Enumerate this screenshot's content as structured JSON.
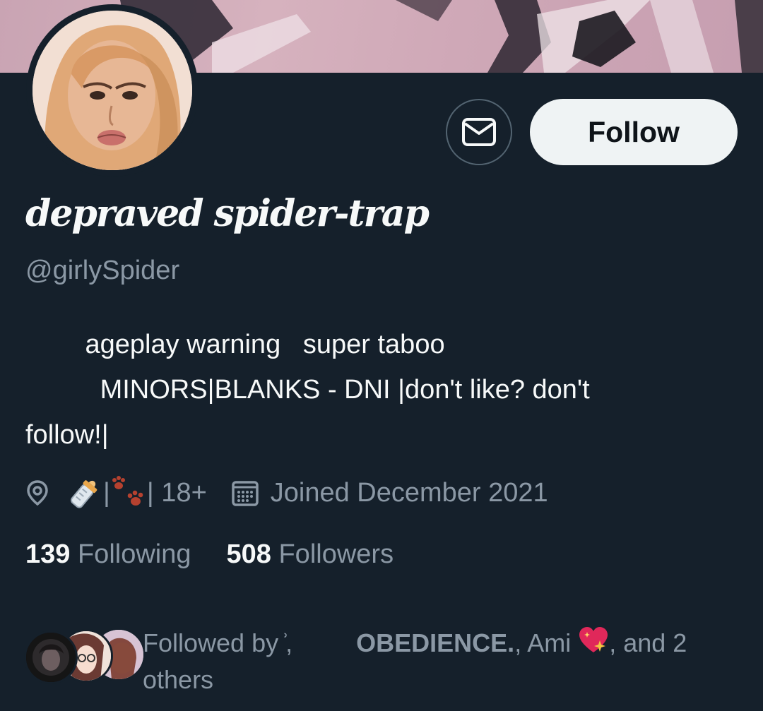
{
  "profile": {
    "display_name": "depraved spider-trap",
    "handle": "@girlySpider",
    "follow_label": "Follow",
    "message_icon": "envelope-icon",
    "avatar_icon": "profile-avatar"
  },
  "bio": {
    "line1": "        ageplay warning   super taboo",
    "line2": "          MINORS|BLANKS - DNI |don't like? don't",
    "line3": "follow!|"
  },
  "meta": {
    "location_icon": "location-pin-icon",
    "location_text": "| 18+",
    "location_emoji": [
      "baby-bottle-icon",
      "paw-prints-icon"
    ],
    "calendar_icon": "calendar-icon",
    "joined": "Joined December 2021"
  },
  "counts": {
    "following_count": "139",
    "following_label": "Following",
    "followers_count": "508",
    "followers_label": "Followers"
  },
  "followed_by": {
    "prefix": "Followed by ͗,",
    "name1": "OBEDIENCE.",
    "middle": ", Ami",
    "heart_icon": "sparkling-heart-icon",
    "suffix": ", and 2",
    "line2": "others"
  },
  "colors": {
    "background": "#15202b",
    "text_primary": "#f7f9f9",
    "text_secondary": "#8b98a5",
    "button_bg": "#eff3f4",
    "border": "#536471"
  }
}
